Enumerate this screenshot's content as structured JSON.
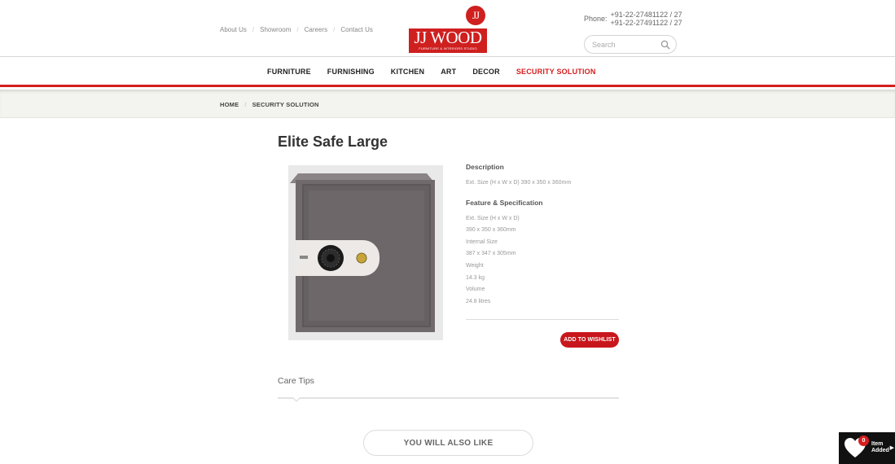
{
  "header": {
    "top_links": [
      "About Us",
      "Showroom",
      "Careers",
      "Contact Us"
    ],
    "logo": {
      "badge": "JJ",
      "word": "JJ WOOD",
      "tagline": "FURNITURE & INTERIORS STUDIO"
    },
    "phone": {
      "label": "Phone:",
      "numbers": [
        "+91-22-27481122 / 27",
        "+91-22-27491122 / 27"
      ]
    },
    "search": {
      "placeholder": "Search"
    }
  },
  "nav": {
    "items": [
      "FURNITURE",
      "FURNISHING",
      "KITCHEN",
      "ART",
      "DECOR",
      "SECURITY SOLUTION"
    ],
    "active": "SECURITY SOLUTION"
  },
  "breadcrumb": [
    "HOME",
    "SECURITY SOLUTION"
  ],
  "product": {
    "title": "Elite Safe Large",
    "description_heading": "Description",
    "description_text": "Ext. Size (H x W x D) 390 x 350 x 360mm",
    "feature_heading": "Feature & Specification",
    "features": [
      "Ext. Size (H x W x D)",
      "390 x 350 x 360mm",
      "Internal Size",
      "387 x 347 x 305mm",
      "Weight",
      "14.3 kg",
      "Volume",
      "24.8 litres"
    ],
    "wishlist_button": "ADD TO WISHLIST"
  },
  "care_tips": {
    "title": "Care Tips"
  },
  "also_like": {
    "label": "YOU WILL ALSO LIKE"
  },
  "wishlist_widget": {
    "count": "0",
    "label": "Item Added"
  },
  "colors": {
    "brand_red": "#d51e1e"
  }
}
